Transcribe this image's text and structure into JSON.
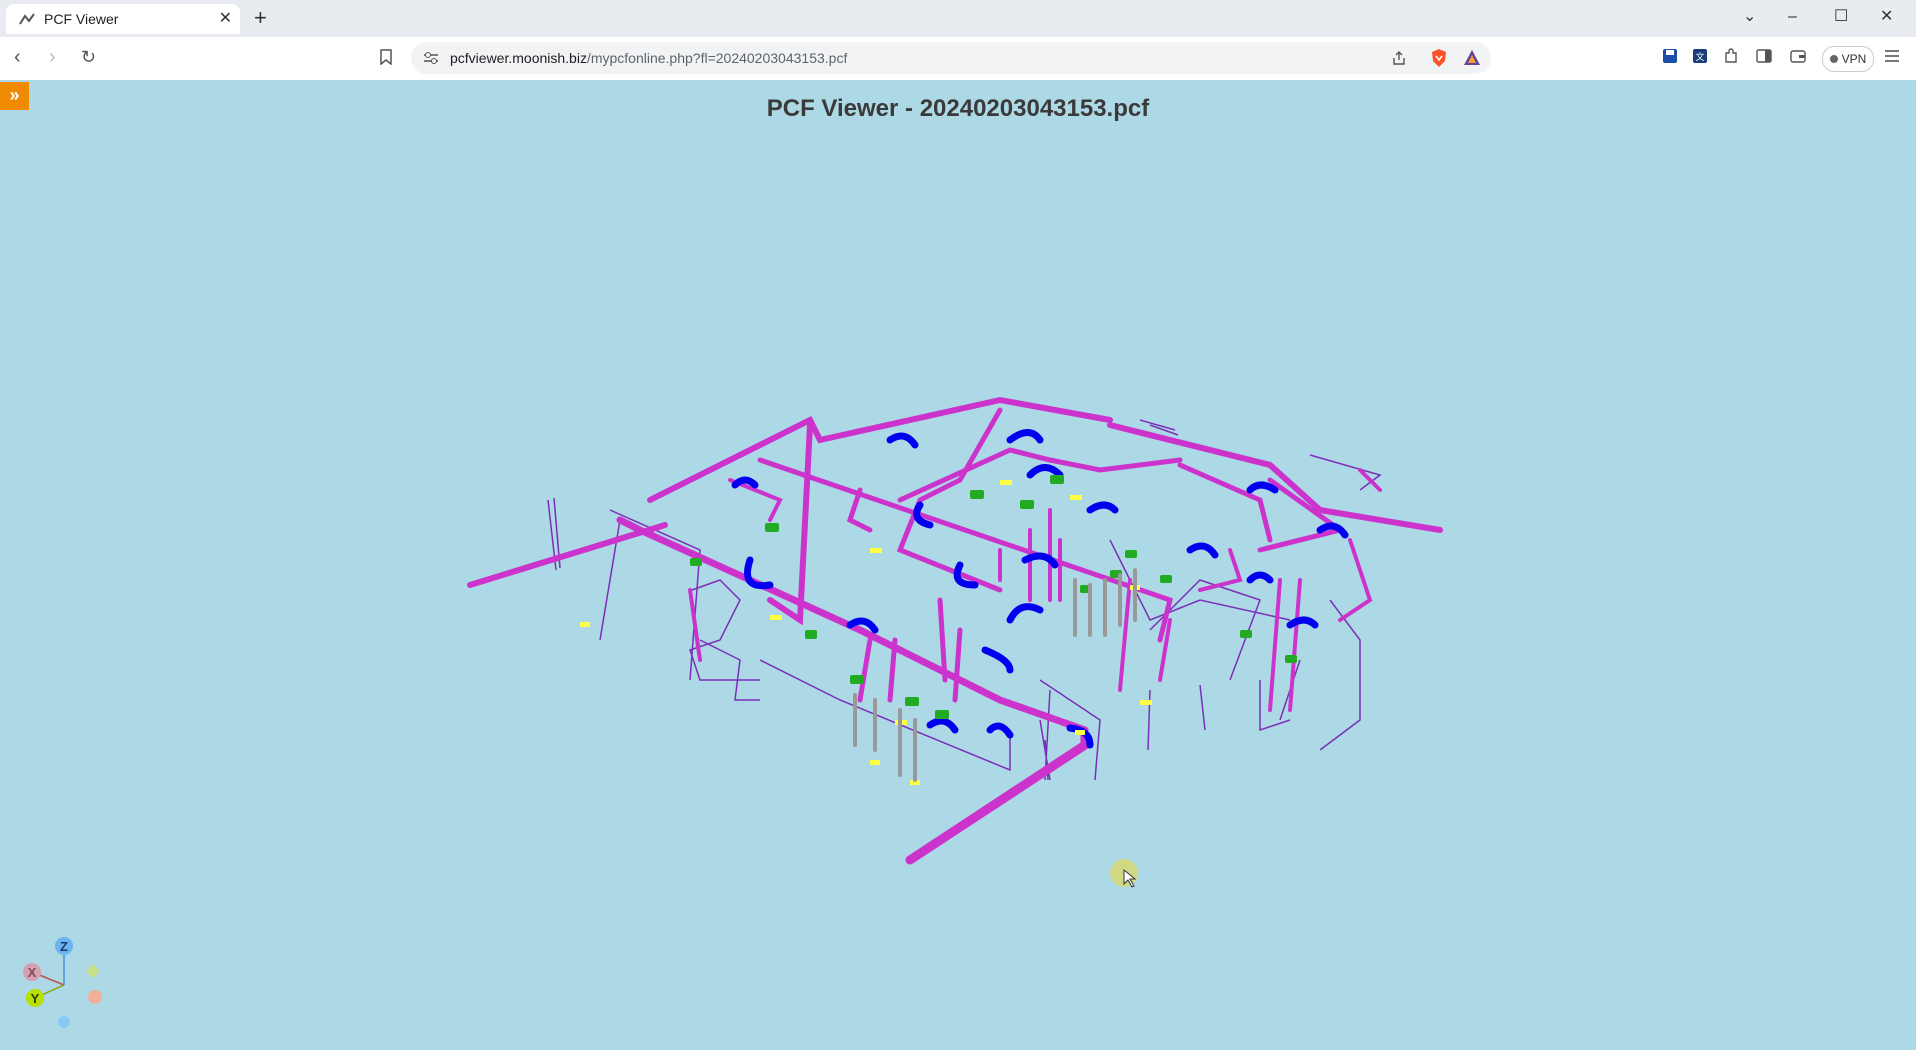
{
  "browser": {
    "tab_title": "PCF Viewer",
    "url_domain": "pcfviewer.moonish.biz",
    "url_path": "/mypcfonline.php?fl=20240203043153.pcf",
    "vpn_label": "VPN"
  },
  "viewer": {
    "title": "PCF Viewer - 20240203043153.pcf",
    "sidebar_toggle": "»",
    "axes": {
      "z": "Z",
      "x": "X",
      "y": "Y"
    },
    "colors": {
      "background": "#add8e6",
      "pipe": "#cc33cc",
      "elbow": "#0000ee",
      "flange": "#22aa22",
      "valve": "#ffff44",
      "support": "#999999",
      "accent": "#f08a00"
    }
  }
}
